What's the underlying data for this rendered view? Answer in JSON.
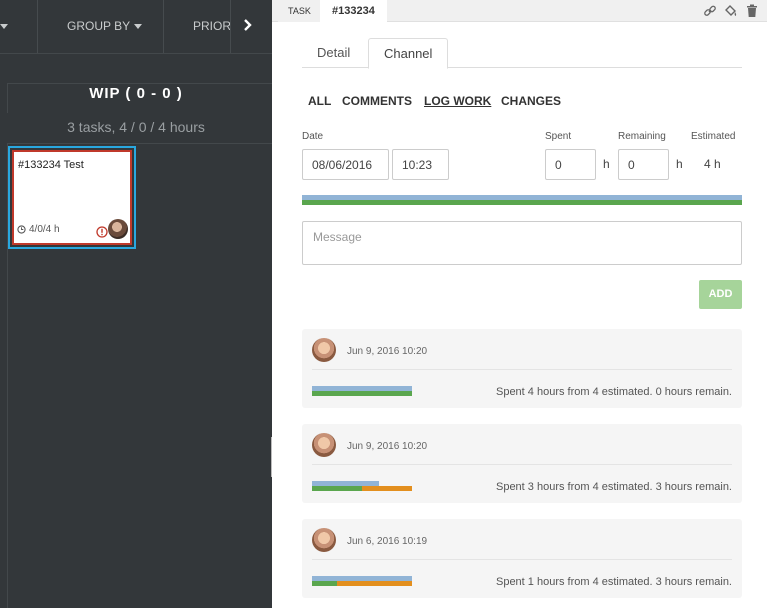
{
  "board": {
    "toolbar": {
      "group_by": "GROUP BY",
      "priority": "PRIORI"
    },
    "column": {
      "title": "WIP  ( 0 - 0 )",
      "subtitle": "3 tasks, 4 / 0 / 4 hours"
    },
    "card": {
      "title": "#133234 Test",
      "hours": "4/0/4 h",
      "border_color": "#c0392b",
      "selected_color": "#29a8e0"
    }
  },
  "panel": {
    "header": {
      "task_label": "TASK",
      "task_id": "#133234",
      "icons": [
        "link-icon",
        "paint-bucket-icon",
        "trash-icon"
      ]
    },
    "tabs": [
      {
        "label": "Detail",
        "active": false
      },
      {
        "label": "Channel",
        "active": true
      }
    ],
    "filters": [
      "ALL",
      "COMMENTS",
      "LOG WORK",
      "CHANGES"
    ],
    "form": {
      "date_label": "Date",
      "date_value": "08/06/2016",
      "time_value": "10:23",
      "spent_label": "Spent",
      "spent_value": "0",
      "spent_unit": "h",
      "remaining_label": "Remaining",
      "remaining_value": "0",
      "remaining_unit": "h",
      "estimated_label": "Estimated",
      "estimated_value": "4 h",
      "message_placeholder": "Message",
      "add_label": "ADD"
    },
    "logs": [
      {
        "date": "Jun 9, 2016 10:20",
        "text": "Spent 4 hours from 4 estimated. 0 hours remain.",
        "spent_fraction": 1.0,
        "remaining_fraction": 0.0
      },
      {
        "date": "Jun 9, 2016 10:20",
        "text": "Spent 3 hours from 4 estimated. 3 hours remain.",
        "spent_fraction": 0.5,
        "remaining_fraction": 0.5,
        "logged_fraction": 0.67
      },
      {
        "date": "Jun 6, 2016 10:19",
        "text": "Spent 1 hours from 4 estimated. 3 hours remain.",
        "spent_fraction": 0.25,
        "remaining_fraction": 0.75
      }
    ]
  },
  "colors": {
    "spent": "#5aa64e",
    "remaining": "#e38f1e",
    "estimate": "#91b4d6",
    "add_button": "#a6d49a"
  }
}
